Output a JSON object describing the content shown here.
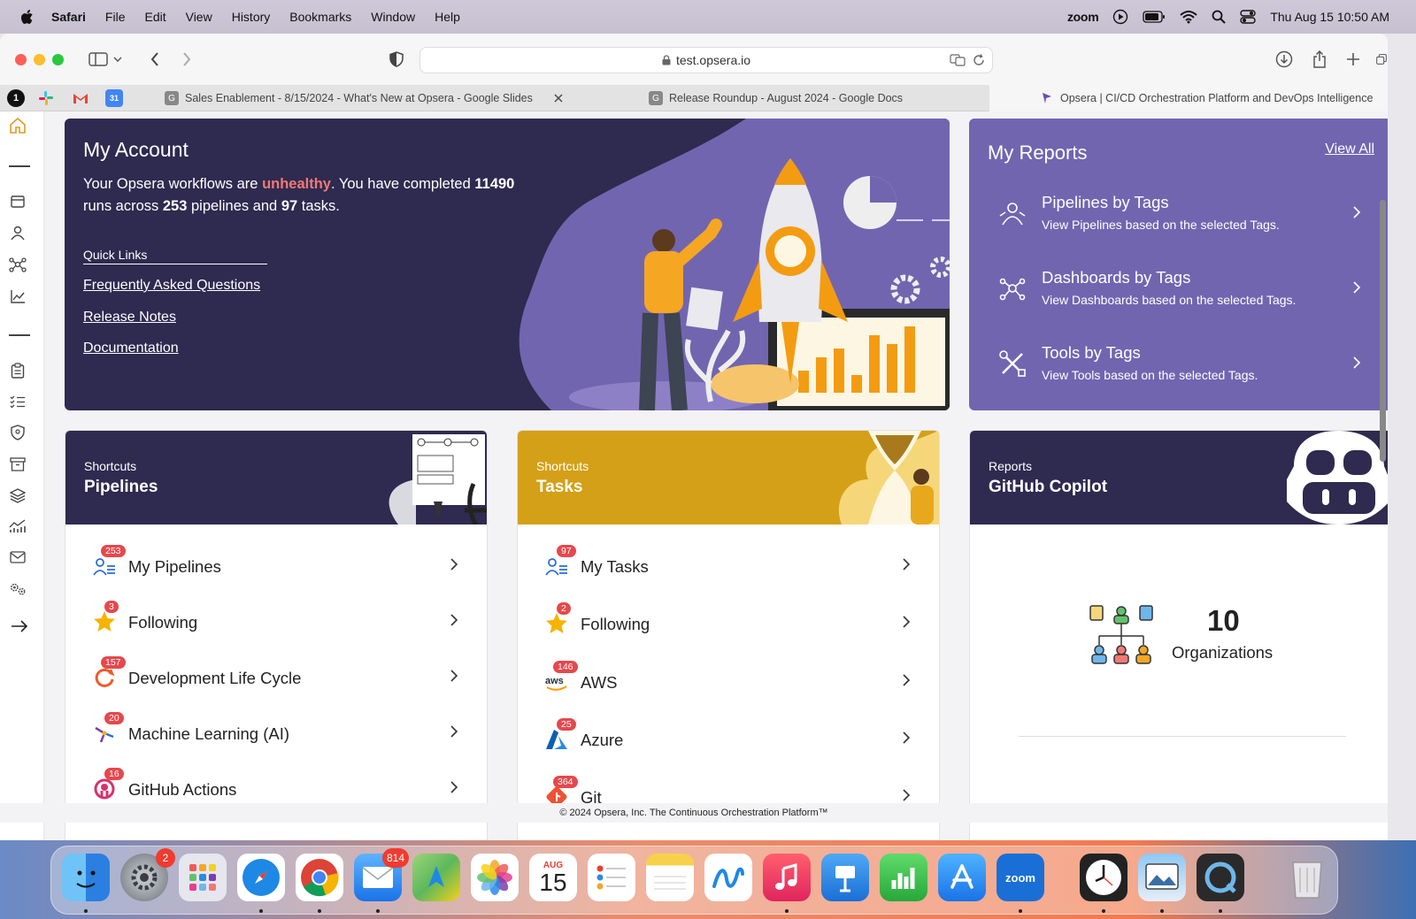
{
  "menubar": {
    "app": "Safari",
    "items": [
      "File",
      "Edit",
      "View",
      "History",
      "Bookmarks",
      "Window",
      "Help"
    ],
    "zoom": "zoom",
    "clock": "Thu Aug 15  10:50 AM"
  },
  "browser": {
    "url": "test.opsera.io",
    "tabs": [
      {
        "title": "Sales Enablement - 8/15/2024 - What's New at Opsera - Google Slides"
      },
      {
        "title": "Release Roundup - August 2024 - Google Docs"
      },
      {
        "title": "Opsera | CI/CD Orchestration Platform and DevOps Intelligence"
      }
    ]
  },
  "account": {
    "title": "My Account",
    "text1": "Your Opsera workflows are ",
    "status": "unhealthy",
    "text2": ". You have completed ",
    "runs": "11490",
    "text3": " runs across ",
    "pipelines": "253",
    "text4": " pipelines and ",
    "tasks": "97",
    "text5": " tasks.",
    "quick_links_label": "Quick Links",
    "links": [
      "Frequently Asked Questions",
      "Release Notes",
      "Documentation"
    ]
  },
  "reports": {
    "title": "My Reports",
    "view_all": "View All",
    "items": [
      {
        "title": "Pipelines by Tags",
        "subtitle": "View Pipelines based on the selected Tags."
      },
      {
        "title": "Dashboards by Tags",
        "subtitle": "View Dashboards based on the selected Tags."
      },
      {
        "title": "Tools by Tags",
        "subtitle": "View Tools based on the selected Tags."
      }
    ]
  },
  "pipelines_card": {
    "kicker": "Shortcuts",
    "title": "Pipelines",
    "items": [
      {
        "label": "My Pipelines",
        "count": "253"
      },
      {
        "label": "Following",
        "count": "3"
      },
      {
        "label": "Development Life Cycle",
        "count": "157"
      },
      {
        "label": "Machine Learning (AI)",
        "count": "20"
      },
      {
        "label": "GitHub Actions",
        "count": "16"
      }
    ]
  },
  "tasks_card": {
    "kicker": "Shortcuts",
    "title": "Tasks",
    "items": [
      {
        "label": "My Tasks",
        "count": "97"
      },
      {
        "label": "Following",
        "count": "2"
      },
      {
        "label": "AWS",
        "count": "146"
      },
      {
        "label": "Azure",
        "count": "25"
      },
      {
        "label": "Git",
        "count": "364"
      }
    ]
  },
  "copilot_card": {
    "kicker": "Reports",
    "title": "GitHub Copilot",
    "value": "10",
    "value_label": "Organizations"
  },
  "footer": "© 2024 Opsera, Inc. The Continuous Orchestration Platform™",
  "dock": {
    "badges": {
      "settings": "2",
      "mail": "814"
    },
    "calendar_month": "AUG",
    "calendar_day": "15",
    "zoom_label": "zoom"
  },
  "colors": {
    "account_bg": "#2f2a4f",
    "reports_bg": "#7265b0",
    "tasks_head": "#d4a017",
    "unhealthy": "#f07a73",
    "badge": "#e5484d"
  }
}
